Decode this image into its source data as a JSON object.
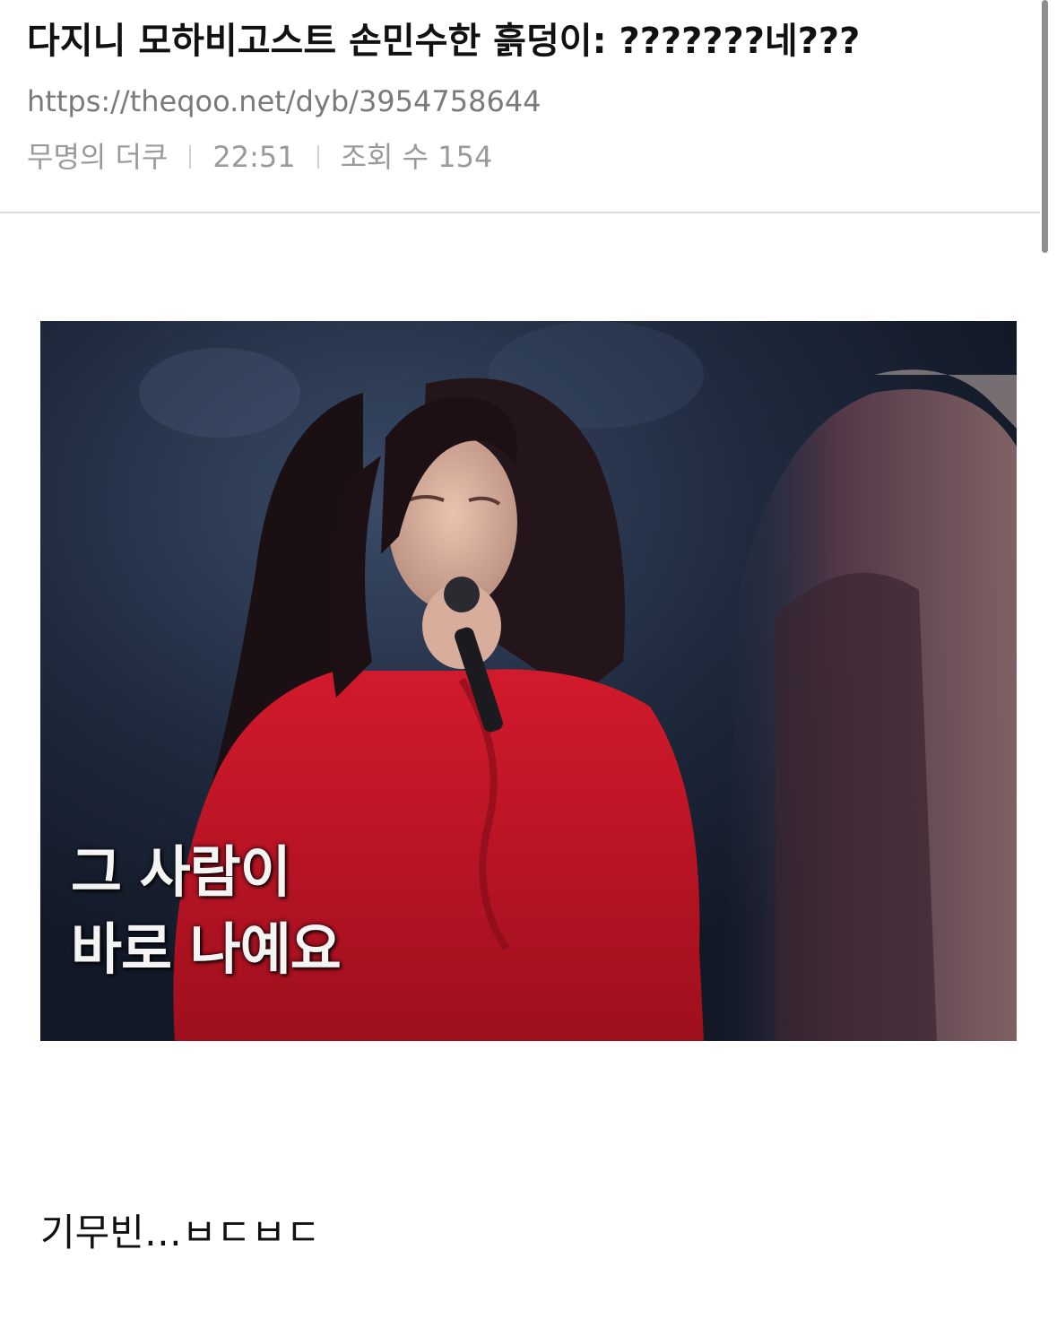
{
  "post": {
    "title": "다지니 모하비고스트 손민수한 흙덩이: ???????네???",
    "url": "https://theqoo.net/dyb/3954758644",
    "author": "무명의 더쿠",
    "time": "22:51",
    "views": "조회 수 154"
  },
  "image": {
    "caption_line1": "그 사람이",
    "caption_line2": "바로 나예요"
  },
  "body": {
    "text": "기무빈…ㅂㄷㅂㄷ"
  }
}
